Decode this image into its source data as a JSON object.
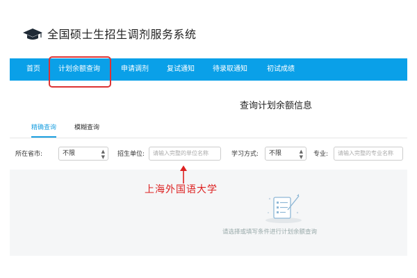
{
  "app": {
    "title": "全国硕士生招生调剂服务系统"
  },
  "nav": {
    "items": [
      "首页",
      "计划余额查询",
      "申请调剂",
      "复试通知",
      "待录取通知",
      "初试成绩"
    ],
    "active_index": 1
  },
  "section": {
    "title": "查询计划余额信息"
  },
  "tabs": {
    "items": [
      "精确查询",
      "模糊查询"
    ],
    "active_index": 0
  },
  "filters": {
    "province_label": "所在省市:",
    "province_value": "不限",
    "unit_label": "招生单位:",
    "unit_placeholder": "请输入完整的单位名称",
    "study_mode_label": "学习方式:",
    "study_mode_value": "不限",
    "major_label": "专业:",
    "major_placeholder": "请输入完整的专业名称"
  },
  "annotation": {
    "text": "上海外国语大学"
  },
  "empty_state": {
    "text": "请选择或填写条件进行计划余额查询"
  },
  "colors": {
    "nav_bg": "#0aa0e8",
    "accent": "#1a9fe0",
    "annotation": "#d22222"
  }
}
